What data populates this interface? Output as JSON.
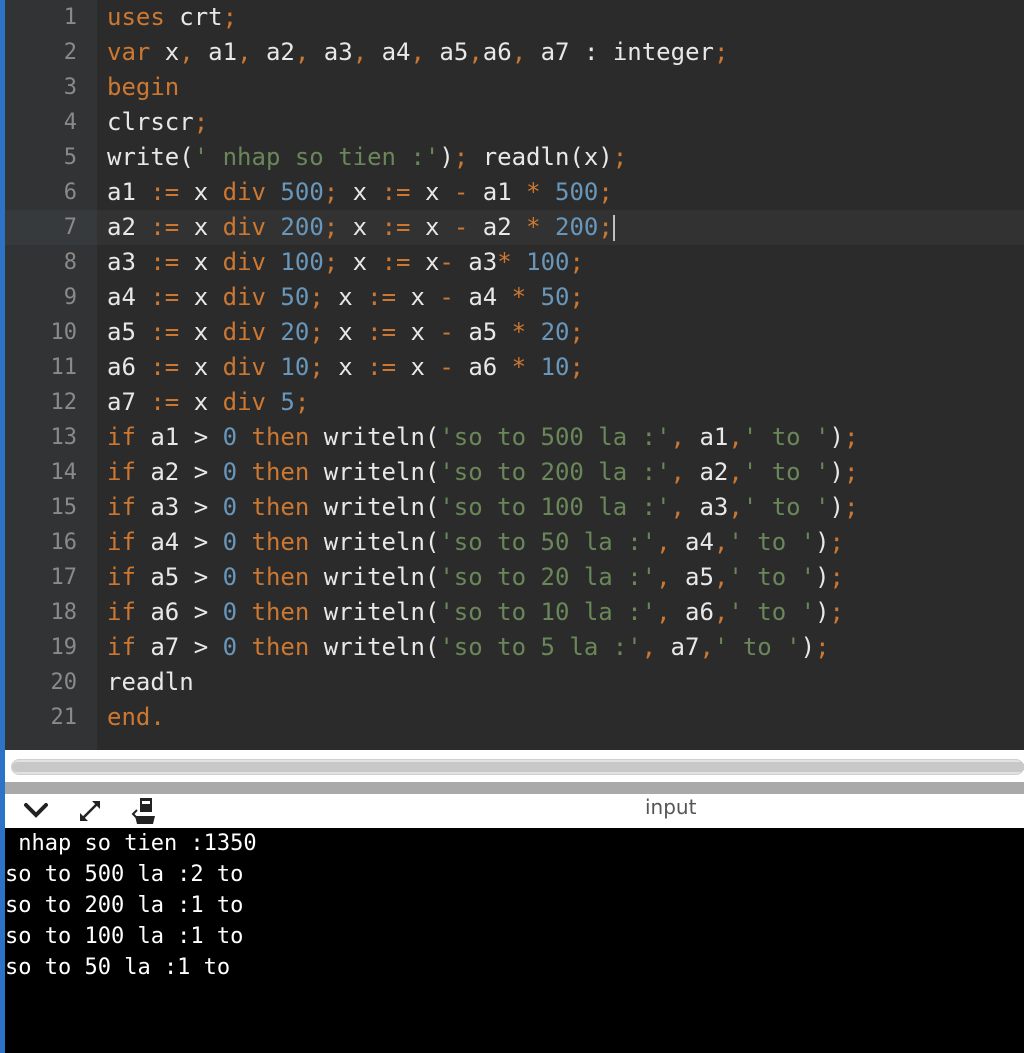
{
  "editor": {
    "lines": [
      {
        "n": "1",
        "tokens": [
          [
            "kw",
            "uses"
          ],
          [
            "id",
            " crt"
          ],
          [
            "op",
            ";"
          ]
        ]
      },
      {
        "n": "2",
        "tokens": [
          [
            "kw",
            "var"
          ],
          [
            "id",
            " x"
          ],
          [
            "op",
            ","
          ],
          [
            "id",
            " a1"
          ],
          [
            "op",
            ","
          ],
          [
            "id",
            " a2"
          ],
          [
            "op",
            ","
          ],
          [
            "id",
            " a3"
          ],
          [
            "op",
            ","
          ],
          [
            "id",
            " a4"
          ],
          [
            "op",
            ","
          ],
          [
            "id",
            " a5"
          ],
          [
            "op",
            ","
          ],
          [
            "id",
            "a6"
          ],
          [
            "op",
            ","
          ],
          [
            "id",
            " a7 : integer"
          ],
          [
            "op",
            ";"
          ]
        ]
      },
      {
        "n": "3",
        "tokens": [
          [
            "kw",
            "begin"
          ]
        ]
      },
      {
        "n": "4",
        "tokens": [
          [
            "id",
            "clrscr"
          ],
          [
            "op",
            ";"
          ]
        ]
      },
      {
        "n": "5",
        "tokens": [
          [
            "id",
            "write("
          ],
          [
            "str",
            "' nhap so tien :'"
          ],
          [
            "id",
            ")"
          ],
          [
            "op",
            ";"
          ],
          [
            "id",
            " readln(x)"
          ],
          [
            "op",
            ";"
          ]
        ]
      },
      {
        "n": "6",
        "tokens": [
          [
            "id",
            "a1 "
          ],
          [
            "op",
            ":="
          ],
          [
            "id",
            " x "
          ],
          [
            "kw",
            "div"
          ],
          [
            "num",
            " 500"
          ],
          [
            "op",
            ";"
          ],
          [
            "id",
            " x "
          ],
          [
            "op",
            ":="
          ],
          [
            "id",
            " x "
          ],
          [
            "op",
            "-"
          ],
          [
            "id",
            " a1 "
          ],
          [
            "op",
            "*"
          ],
          [
            "num",
            " 500"
          ],
          [
            "op",
            ";"
          ]
        ]
      },
      {
        "n": "7",
        "tokens": [
          [
            "id",
            "a2 "
          ],
          [
            "op",
            ":="
          ],
          [
            "id",
            " x "
          ],
          [
            "kw",
            "div"
          ],
          [
            "num",
            " 200"
          ],
          [
            "op",
            ";"
          ],
          [
            "id",
            " x "
          ],
          [
            "op",
            ":="
          ],
          [
            "id",
            " x "
          ],
          [
            "op",
            "-"
          ],
          [
            "id",
            " a2 "
          ],
          [
            "op",
            "*"
          ],
          [
            "num",
            " 200"
          ],
          [
            "op",
            ";"
          ]
        ]
      },
      {
        "n": "8",
        "tokens": [
          [
            "id",
            "a3 "
          ],
          [
            "op",
            ":="
          ],
          [
            "id",
            " x "
          ],
          [
            "kw",
            "div"
          ],
          [
            "num",
            " 100"
          ],
          [
            "op",
            ";"
          ],
          [
            "id",
            " x "
          ],
          [
            "op",
            ":="
          ],
          [
            "id",
            " x"
          ],
          [
            "op",
            "-"
          ],
          [
            "id",
            " a3"
          ],
          [
            "op",
            "*"
          ],
          [
            "num",
            " 100"
          ],
          [
            "op",
            ";"
          ]
        ]
      },
      {
        "n": "9",
        "tokens": [
          [
            "id",
            "a4 "
          ],
          [
            "op",
            ":="
          ],
          [
            "id",
            " x "
          ],
          [
            "kw",
            "div"
          ],
          [
            "num",
            " 50"
          ],
          [
            "op",
            ";"
          ],
          [
            "id",
            " x "
          ],
          [
            "op",
            ":="
          ],
          [
            "id",
            " x "
          ],
          [
            "op",
            "-"
          ],
          [
            "id",
            " a4 "
          ],
          [
            "op",
            "*"
          ],
          [
            "num",
            " 50"
          ],
          [
            "op",
            ";"
          ]
        ]
      },
      {
        "n": "10",
        "tokens": [
          [
            "id",
            "a5 "
          ],
          [
            "op",
            ":="
          ],
          [
            "id",
            " x "
          ],
          [
            "kw",
            "div"
          ],
          [
            "num",
            " 20"
          ],
          [
            "op",
            ";"
          ],
          [
            "id",
            " x "
          ],
          [
            "op",
            ":="
          ],
          [
            "id",
            " x "
          ],
          [
            "op",
            "-"
          ],
          [
            "id",
            " a5 "
          ],
          [
            "op",
            "*"
          ],
          [
            "num",
            " 20"
          ],
          [
            "op",
            ";"
          ]
        ]
      },
      {
        "n": "11",
        "tokens": [
          [
            "id",
            "a6 "
          ],
          [
            "op",
            ":="
          ],
          [
            "id",
            " x "
          ],
          [
            "kw",
            "div"
          ],
          [
            "num",
            " 10"
          ],
          [
            "op",
            ";"
          ],
          [
            "id",
            " x "
          ],
          [
            "op",
            ":="
          ],
          [
            "id",
            " x "
          ],
          [
            "op",
            "-"
          ],
          [
            "id",
            " a6 "
          ],
          [
            "op",
            "*"
          ],
          [
            "num",
            " 10"
          ],
          [
            "op",
            ";"
          ]
        ]
      },
      {
        "n": "12",
        "tokens": [
          [
            "id",
            "a7 "
          ],
          [
            "op",
            ":="
          ],
          [
            "id",
            " x "
          ],
          [
            "kw",
            "div"
          ],
          [
            "num",
            " 5"
          ],
          [
            "op",
            ";"
          ]
        ]
      },
      {
        "n": "13",
        "tokens": [
          [
            "kw",
            "if"
          ],
          [
            "id",
            " a1 > "
          ],
          [
            "num",
            "0"
          ],
          [
            "kw",
            " then"
          ],
          [
            "id",
            " writeln("
          ],
          [
            "str",
            "'so to 500 la :'"
          ],
          [
            "op",
            ","
          ],
          [
            "id",
            " a1"
          ],
          [
            "op",
            ","
          ],
          [
            "str",
            "' to '"
          ],
          [
            "id",
            ")"
          ],
          [
            "op",
            ";"
          ]
        ]
      },
      {
        "n": "14",
        "tokens": [
          [
            "kw",
            "if"
          ],
          [
            "id",
            " a2 > "
          ],
          [
            "num",
            "0"
          ],
          [
            "kw",
            " then"
          ],
          [
            "id",
            " writeln("
          ],
          [
            "str",
            "'so to 200 la :'"
          ],
          [
            "op",
            ","
          ],
          [
            "id",
            " a2"
          ],
          [
            "op",
            ","
          ],
          [
            "str",
            "' to '"
          ],
          [
            "id",
            ")"
          ],
          [
            "op",
            ";"
          ]
        ]
      },
      {
        "n": "15",
        "tokens": [
          [
            "kw",
            "if"
          ],
          [
            "id",
            " a3 > "
          ],
          [
            "num",
            "0"
          ],
          [
            "kw",
            " then"
          ],
          [
            "id",
            " writeln("
          ],
          [
            "str",
            "'so to 100 la :'"
          ],
          [
            "op",
            ","
          ],
          [
            "id",
            " a3"
          ],
          [
            "op",
            ","
          ],
          [
            "str",
            "' to '"
          ],
          [
            "id",
            ")"
          ],
          [
            "op",
            ";"
          ]
        ]
      },
      {
        "n": "16",
        "tokens": [
          [
            "kw",
            "if"
          ],
          [
            "id",
            " a4 > "
          ],
          [
            "num",
            "0"
          ],
          [
            "kw",
            " then"
          ],
          [
            "id",
            " writeln("
          ],
          [
            "str",
            "'so to 50 la :'"
          ],
          [
            "op",
            ","
          ],
          [
            "id",
            " a4"
          ],
          [
            "op",
            ","
          ],
          [
            "str",
            "' to '"
          ],
          [
            "id",
            ")"
          ],
          [
            "op",
            ";"
          ]
        ]
      },
      {
        "n": "17",
        "tokens": [
          [
            "kw",
            "if"
          ],
          [
            "id",
            " a5 > "
          ],
          [
            "num",
            "0"
          ],
          [
            "kw",
            " then"
          ],
          [
            "id",
            " writeln("
          ],
          [
            "str",
            "'so to 20 la :'"
          ],
          [
            "op",
            ","
          ],
          [
            "id",
            " a5"
          ],
          [
            "op",
            ","
          ],
          [
            "str",
            "' to '"
          ],
          [
            "id",
            ")"
          ],
          [
            "op",
            ";"
          ]
        ]
      },
      {
        "n": "18",
        "tokens": [
          [
            "kw",
            "if"
          ],
          [
            "id",
            " a6 > "
          ],
          [
            "num",
            "0"
          ],
          [
            "kw",
            " then"
          ],
          [
            "id",
            " writeln("
          ],
          [
            "str",
            "'so to 10 la :'"
          ],
          [
            "op",
            ","
          ],
          [
            "id",
            " a6"
          ],
          [
            "op",
            ","
          ],
          [
            "str",
            "' to '"
          ],
          [
            "id",
            ")"
          ],
          [
            "op",
            ";"
          ]
        ]
      },
      {
        "n": "19",
        "tokens": [
          [
            "kw",
            "if"
          ],
          [
            "id",
            " a7 > "
          ],
          [
            "num",
            "0"
          ],
          [
            "kw",
            " then"
          ],
          [
            "id",
            " writeln("
          ],
          [
            "str",
            "'so to 5 la :'"
          ],
          [
            "op",
            ","
          ],
          [
            "id",
            " a7"
          ],
          [
            "op",
            ","
          ],
          [
            "str",
            "' to '"
          ],
          [
            "id",
            ")"
          ],
          [
            "op",
            ";"
          ]
        ]
      },
      {
        "n": "20",
        "tokens": [
          [
            "id",
            "readln"
          ]
        ]
      },
      {
        "n": "21",
        "tokens": [
          [
            "kw",
            "end"
          ],
          [
            "op",
            "."
          ]
        ]
      }
    ],
    "current_line": "7"
  },
  "panel": {
    "title": "input",
    "icons": [
      "chevron-down-icon",
      "expand-icon",
      "clear-icon"
    ]
  },
  "console": {
    "lines": [
      " nhap so tien :1350",
      "so to 500 la :2 to",
      "so to 200 la :1 to",
      "so to 100 la :1 to",
      "so to 50 la :1 to"
    ]
  },
  "colors": {
    "keyword": "#cc7832",
    "number": "#6897bb",
    "string": "#6a8759",
    "identifier": "#e8e8e8",
    "background": "#2b2b2b",
    "gutter": "#313335",
    "console_bg": "#000000"
  }
}
